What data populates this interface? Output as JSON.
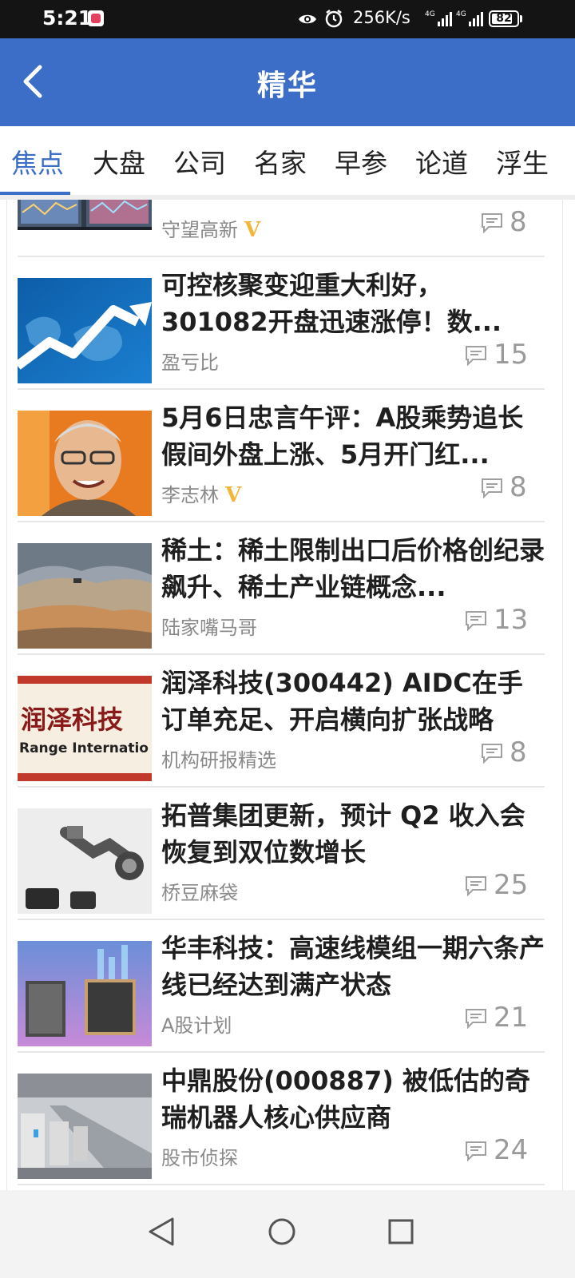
{
  "status_bar": {
    "time": "5:21",
    "net_speed": "256K/s",
    "battery": "82",
    "battery_level": 0.82
  },
  "header": {
    "title": "精华",
    "back_icon": "chevron-left-icon"
  },
  "tabs": [
    {
      "label": "焦点",
      "active": true
    },
    {
      "label": "大盘",
      "active": false
    },
    {
      "label": "公司",
      "active": false
    },
    {
      "label": "名家",
      "active": false
    },
    {
      "label": "早参",
      "active": false
    },
    {
      "label": "论道",
      "active": false
    },
    {
      "label": "浮生",
      "active": false
    }
  ],
  "colors": {
    "header_blue": "#3d6ec7",
    "verified_gold": "#f2b63b",
    "title_text": "#1f1f1f",
    "meta_text": "#8a8a8a"
  },
  "articles": [
    {
      "title": "",
      "author": "守望高新",
      "verified": true,
      "comments": "8",
      "thumb": "stock-monitors"
    },
    {
      "title": "可控核聚变迎重大利好，301082开盘迅速涨停！数...",
      "author": "盈亏比",
      "verified": false,
      "comments": "15",
      "thumb": "world-map-arrow"
    },
    {
      "title": "5月6日忠言午评：A股乘势追长假间外盘上涨、5月开门红...",
      "author": "李志林",
      "verified": true,
      "comments": "8",
      "thumb": "portrait"
    },
    {
      "title": "稀土：稀土限制出口后价格创纪录飙升、稀土产业链概念...",
      "author": "陆家嘴马哥",
      "verified": false,
      "comments": "13",
      "thumb": "mine"
    },
    {
      "title": "润泽科技(300442) AIDC在手订单充足、开启横向扩张战略",
      "author": "机构研报精选",
      "verified": false,
      "comments": "8",
      "thumb": "sign",
      "thumb_text_cn": "润泽科技",
      "thumb_text_en": "Range Internatio"
    },
    {
      "title": "拓普集团更新，预计 Q2 收入会恢复到双位数增长",
      "author": "桥豆麻袋",
      "verified": false,
      "comments": "25",
      "thumb": "robot-arm"
    },
    {
      "title": "华丰科技：高速线模组一期六条产线已经达到满产状态",
      "author": "A股计划",
      "verified": false,
      "comments": "21",
      "thumb": "connectors"
    },
    {
      "title": "中鼎股份(000887) 被低估的奇瑞机器人核心供应商",
      "author": "股市侦探",
      "verified": false,
      "comments": "24",
      "thumb": "factory"
    }
  ],
  "nav": {
    "back": "triangle-back-icon",
    "home": "circle-home-icon",
    "recents": "square-recents-icon"
  }
}
